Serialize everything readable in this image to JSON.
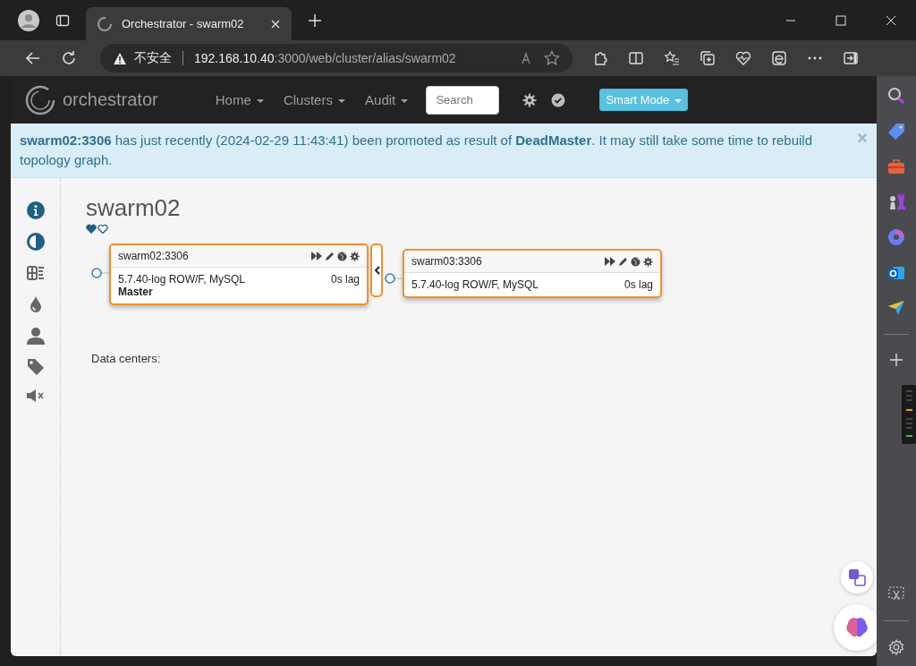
{
  "browser": {
    "tab_title": "Orchestrator - swarm02",
    "security_label": "不安全",
    "address_host": "192.168.10.40",
    "address_rest": ":3000/web/cluster/alias/swarm02"
  },
  "navbar": {
    "brand": "orchestrator",
    "menus": [
      "Home",
      "Clusters",
      "Audit"
    ],
    "search": {
      "placeholder": "Search"
    },
    "mode_button": "Smart Mode"
  },
  "alert": {
    "text": "**swarm02:3306** has just recently (2024-02-29 11:43:41) been promoted as result of **DeadMaster**. It may still take some time to rebuild topology graph.",
    "close": "×"
  },
  "cluster": {
    "title": "swarm02"
  },
  "nodes": [
    {
      "name": "swarm02:3306",
      "version": "5.7.40-log ROW/F, MySQL",
      "lag": "0s lag",
      "role": "Master"
    },
    {
      "name": "swarm03:3306",
      "version": "5.7.40-log ROW/F, MySQL",
      "lag": "0s lag"
    }
  ],
  "data_centers_label": "Data centers:"
}
